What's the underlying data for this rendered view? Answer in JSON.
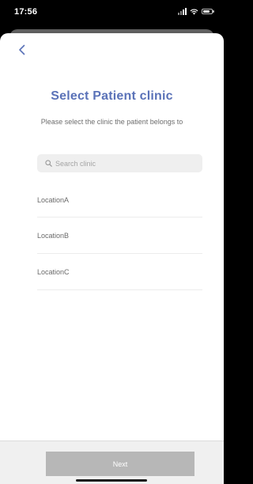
{
  "status_bar": {
    "time": "17:56",
    "icons": [
      "cellular-signal-icon",
      "wifi-icon",
      "battery-icon"
    ]
  },
  "colors": {
    "title": "#5a72b8",
    "next_button_disabled": "#b7b7b7",
    "footer_background": "#f0f0f0",
    "search_background": "#efefef"
  },
  "header": {
    "back_icon": "chevron-left-icon",
    "title": "Select Patient clinic",
    "subtitle": "Please select the clinic the patient belongs to"
  },
  "search": {
    "icon": "search-icon",
    "placeholder": "Search clinic",
    "value": ""
  },
  "clinics": [
    {
      "label": "LocationA"
    },
    {
      "label": "LocationB"
    },
    {
      "label": "LocationC"
    }
  ],
  "footer": {
    "next_label": "Next"
  }
}
